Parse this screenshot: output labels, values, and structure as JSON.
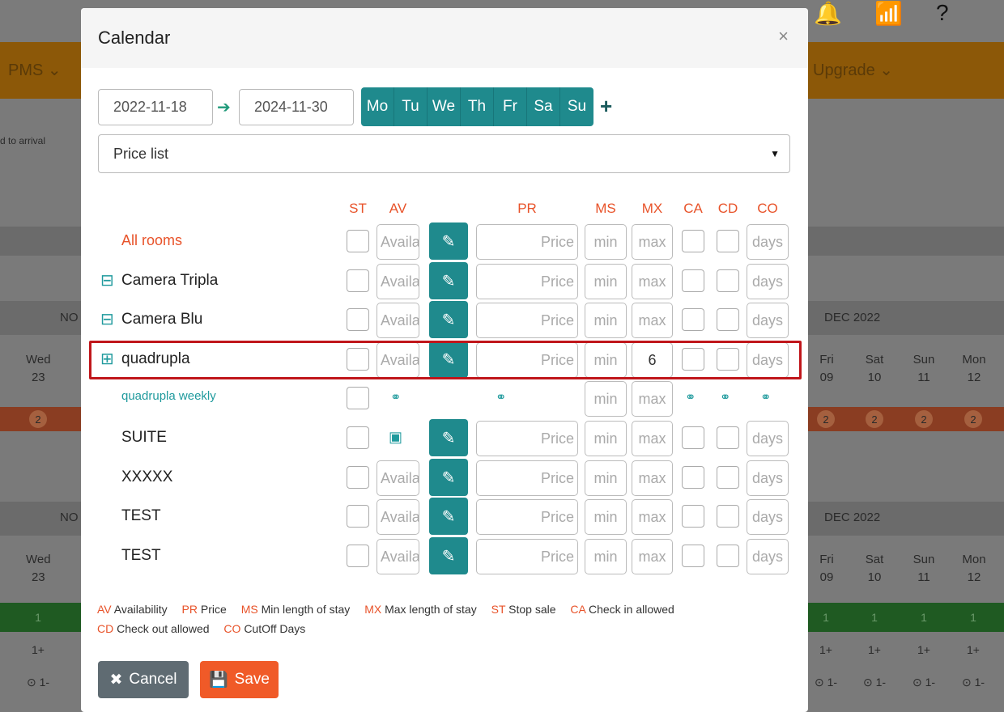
{
  "background": {
    "nav_pms": "PMS ⌄",
    "nav_upgrade": "Upgrade ⌄",
    "to_arrival": "d to arrival",
    "month_left": "NO",
    "month_right": "DEC 2022",
    "left_day": {
      "name": "Wed",
      "num": "23"
    },
    "right_days": [
      {
        "name": "Fri",
        "num": "09"
      },
      {
        "name": "Sat",
        "num": "10"
      },
      {
        "name": "Sun",
        "num": "11"
      },
      {
        "name": "Mon",
        "num": "12"
      }
    ],
    "badge": "2",
    "green_val": "1",
    "min_val": "1+",
    "clock_val": "⊙ 1-"
  },
  "modal": {
    "title": "Calendar",
    "close": "×",
    "date_from": "2022-11-18",
    "date_to": "2024-11-30",
    "arrow": "➔",
    "weekdays": [
      "Mo",
      "Tu",
      "We",
      "Th",
      "Fr",
      "Sa",
      "Su"
    ],
    "add": "+",
    "price_list": "Price list",
    "headers": {
      "st": "ST",
      "av": "AV",
      "pr": "PR",
      "ms": "MS",
      "mx": "MX",
      "ca": "CA",
      "cd": "CD",
      "co": "CO"
    },
    "placeholders": {
      "av": "Availa",
      "pr": "Price",
      "ms": "min",
      "mx": "max",
      "co": "days"
    },
    "rows": [
      {
        "label": "All rooms"
      },
      {
        "label": "Camera Tripla",
        "toggle": "⊟"
      },
      {
        "label": "Camera Blu",
        "toggle": "⊟"
      },
      {
        "label": "quadrupla",
        "toggle": "⊞",
        "mx_value": "6"
      },
      {
        "label": "quadrupla weekly"
      },
      {
        "label": "SUITE"
      },
      {
        "label": "XXXXX"
      },
      {
        "label": "TEST"
      },
      {
        "label": "TEST"
      }
    ],
    "legend": [
      {
        "code": "AV",
        "text": "Availability"
      },
      {
        "code": "PR",
        "text": "Price"
      },
      {
        "code": "MS",
        "text": "Min length of stay"
      },
      {
        "code": "MX",
        "text": "Max length of stay"
      },
      {
        "code": "ST",
        "text": "Stop sale"
      },
      {
        "code": "CA",
        "text": "Check in allowed"
      },
      {
        "code": "CD",
        "text": "Check out allowed"
      },
      {
        "code": "CO",
        "text": "CutOff Days"
      }
    ],
    "cancel": "Cancel",
    "save": "Save"
  },
  "colors": {
    "accent": "#1f8a8d",
    "orange": "#e8532a",
    "highlight": "#c0161b"
  }
}
